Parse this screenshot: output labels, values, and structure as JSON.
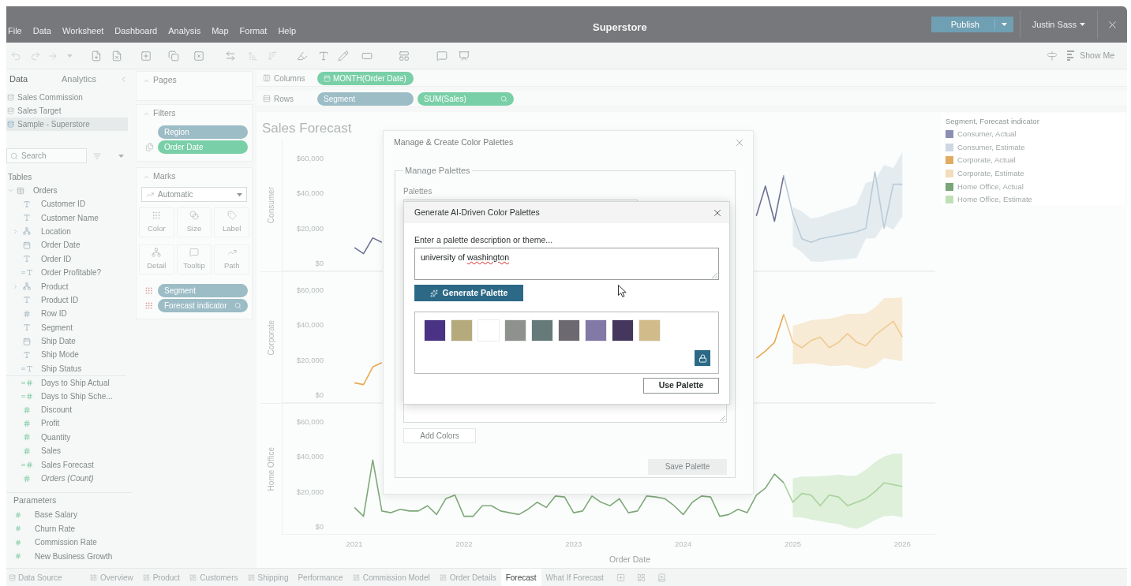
{
  "window": {
    "title": "Superstore",
    "menu": [
      "File",
      "Data",
      "Worksheet",
      "Dashboard",
      "Analysis",
      "Map",
      "Format",
      "Help"
    ],
    "publish": "Publish",
    "user": "Justin Sass"
  },
  "toolbar": {
    "show_me": "Show Me"
  },
  "data_pane": {
    "tabs": [
      {
        "label": "Data",
        "selected": true
      },
      {
        "label": "Analytics",
        "selected": false
      }
    ],
    "data_sources": [
      {
        "label": "Sales Commission",
        "selected": false
      },
      {
        "label": "Sales Target",
        "selected": false
      },
      {
        "label": "Sample - Superstore",
        "selected": true
      }
    ],
    "search": {
      "placeholder": "Search"
    },
    "tables_heading": "Tables",
    "tables": [
      {
        "label": "Orders",
        "expanded": true,
        "children": [
          {
            "label": "Customer ID",
            "kind": "string",
            "measure": false,
            "calculated": false
          },
          {
            "label": "Customer Name",
            "kind": "string",
            "measure": false,
            "calculated": false
          },
          {
            "label": "Location",
            "kind": "hierarchy",
            "measure": false,
            "calculated": false,
            "expanded": false
          },
          {
            "label": "Order Date",
            "kind": "date",
            "measure": false,
            "calculated": false
          },
          {
            "label": "Order ID",
            "kind": "string",
            "measure": false,
            "calculated": false
          },
          {
            "label": "Order Profitable?",
            "kind": "string",
            "measure": false,
            "calculated": true
          },
          {
            "label": "Product",
            "kind": "hierarchy",
            "measure": false,
            "calculated": false,
            "expanded": false
          },
          {
            "label": "Product ID",
            "kind": "string",
            "measure": false,
            "calculated": false
          },
          {
            "label": "Row ID",
            "kind": "number",
            "measure": false,
            "calculated": false
          },
          {
            "label": "Segment",
            "kind": "string",
            "measure": false,
            "calculated": false
          },
          {
            "label": "Ship Date",
            "kind": "date",
            "measure": false,
            "calculated": false
          },
          {
            "label": "Ship Mode",
            "kind": "string",
            "measure": false,
            "calculated": false
          },
          {
            "label": "Ship Status",
            "kind": "string",
            "measure": false,
            "calculated": true
          },
          {
            "label": "Days to Ship Actual",
            "kind": "number",
            "measure": true,
            "calculated": true
          },
          {
            "label": "Days to Ship Sche...",
            "kind": "number",
            "measure": true,
            "calculated": true
          },
          {
            "label": "Discount",
            "kind": "number",
            "measure": true,
            "calculated": false
          },
          {
            "label": "Profit",
            "kind": "number",
            "measure": true,
            "calculated": false
          },
          {
            "label": "Quantity",
            "kind": "number",
            "measure": true,
            "calculated": false
          },
          {
            "label": "Sales",
            "kind": "number",
            "measure": true,
            "calculated": false
          },
          {
            "label": "Sales Forecast",
            "kind": "number",
            "measure": true,
            "calculated": true
          },
          {
            "label": "Orders (Count)",
            "kind": "number",
            "measure": true,
            "calculated": false,
            "italic": true
          }
        ]
      }
    ],
    "parameters_heading": "Parameters",
    "parameters": [
      {
        "label": "Base Salary"
      },
      {
        "label": "Churn Rate"
      },
      {
        "label": "Commission Rate"
      },
      {
        "label": "New Business Growth"
      }
    ]
  },
  "shelves": {
    "pages": {
      "title": "Pages",
      "expanded": true
    },
    "filters": {
      "title": "Filters",
      "expanded": true,
      "pills": [
        {
          "label": "Region",
          "kind": "discrete",
          "shared": false
        },
        {
          "label": "Order Date",
          "kind": "continuous",
          "shared": true
        }
      ]
    },
    "marks": {
      "title": "Marks",
      "expanded": true,
      "mark_type": "Automatic",
      "cards": [
        {
          "label": "Color",
          "kind": "color"
        },
        {
          "label": "Size",
          "kind": "size"
        },
        {
          "label": "Label",
          "kind": "label"
        },
        {
          "label": "Detail",
          "kind": "detail"
        },
        {
          "label": "Tooltip",
          "kind": "tooltip"
        },
        {
          "label": "Path",
          "kind": "path"
        }
      ],
      "pills": [
        {
          "label": "Segment",
          "kind": "discrete",
          "forecast": false
        },
        {
          "label": "Forecast indicator",
          "kind": "discrete",
          "forecast": true
        }
      ]
    }
  },
  "columns_shelf": {
    "label": "Columns",
    "pills": [
      {
        "label": "MONTH(Order Date)",
        "kind": "continuous",
        "date": true,
        "forecast": false
      }
    ]
  },
  "rows_shelf": {
    "label": "Rows",
    "pills": [
      {
        "label": "Segment",
        "kind": "discrete",
        "date": false,
        "forecast": false
      },
      {
        "label": "SUM(Sales)",
        "kind": "continuous",
        "date": false,
        "forecast": true
      }
    ]
  },
  "view": {
    "title": "Sales Forecast",
    "panes": [
      {
        "label": "Consumer",
        "chart_data": {
          "type": "line",
          "x": [
            2021,
            2021.083,
            2021.167,
            2021.25,
            2024.667,
            2024.75,
            2024.833,
            2024.917,
            2025,
            2025.083,
            2025.167,
            2025.25,
            2025.333,
            2025.417,
            2025.5,
            2025.583,
            2025.667,
            2025.75,
            2025.833,
            2025.917,
            2026
          ],
          "xlim": [
            2020.344,
            2026.3
          ],
          "ylim": [
            -4500,
            70400
          ],
          "yticks": [
            {
              "value": 0,
              "label": "$0"
            },
            {
              "value": 20000,
              "label": "$20,000"
            },
            {
              "value": 40000,
              "label": "$40,000"
            },
            {
              "value": 60000,
              "label": "$60,000"
            }
          ],
          "series": [
            {
              "color": "#6e7193",
              "values": [
                9000,
                5500,
                14500,
                12000,
                27000,
                44000,
                24000,
                50000,
                null,
                null,
                null,
                null,
                null,
                null,
                null,
                null,
                null,
                null,
                null,
                null,
                null
              ]
            },
            {
              "color": "#b9cbd8",
              "values": [
                null,
                null,
                null,
                null,
                null,
                null,
                null,
                50000,
                28000,
                14000,
                12000,
                14000,
                15000,
                16000,
                17000,
                18000,
                20000,
                52000,
                20000,
                45000,
                45000
              ]
            }
          ]
        }
      },
      {
        "label": "Corporate",
        "chart_data": {
          "type": "line",
          "x": [
            2021,
            2021.083,
            2021.167,
            2021.25,
            2024.667,
            2024.75,
            2024.833,
            2024.917,
            2025,
            2025.083,
            2025.167,
            2025.25,
            2025.333,
            2025.417,
            2025.5,
            2025.583,
            2025.667,
            2025.75,
            2025.833,
            2025.917,
            2026
          ],
          "xlim": [
            2020.344,
            2026.3
          ],
          "ylim": [
            -4500,
            70400
          ],
          "yticks": [
            {
              "value": 0,
              "label": "$0"
            },
            {
              "value": 20000,
              "label": "$20,000"
            },
            {
              "value": 40000,
              "label": "$40,000"
            },
            {
              "value": 60000,
              "label": "$60,000"
            }
          ],
          "series": [
            {
              "color": "#e9a94e",
              "values": [
                7000,
                6000,
                16000,
                18500,
                21000,
                25000,
                30000,
                46000,
                null,
                null,
                null,
                null,
                null,
                null,
                null,
                null,
                null,
                null,
                null,
                null,
                null
              ]
            },
            {
              "color": "#f0c98f",
              "values": [
                null,
                null,
                null,
                null,
                null,
                null,
                null,
                46000,
                30000,
                27000,
                31000,
                33000,
                27000,
                30000,
                35000,
                30000,
                28000,
                34000,
                38000,
                42000,
                33000
              ]
            }
          ]
        }
      },
      {
        "label": "Home Office",
        "chart_data": {
          "type": "line",
          "xlabel": "Order Date",
          "x": [
            2021,
            2021.083,
            2021.167,
            2021.25,
            2021.333,
            2021.417,
            2021.5,
            2021.583,
            2021.667,
            2021.75,
            2021.833,
            2021.917,
            2022,
            2022.083,
            2022.167,
            2022.25,
            2022.333,
            2022.417,
            2022.5,
            2022.583,
            2022.667,
            2022.75,
            2022.833,
            2022.917,
            2023,
            2023.083,
            2023.167,
            2023.25,
            2023.333,
            2023.417,
            2023.5,
            2023.583,
            2023.667,
            2023.75,
            2023.833,
            2023.917,
            2024,
            2024.083,
            2024.167,
            2024.25,
            2024.333,
            2024.417,
            2024.5,
            2024.583,
            2024.667,
            2024.75,
            2024.833,
            2024.917,
            2025,
            2025.083,
            2025.167,
            2025.25,
            2025.333,
            2025.417,
            2025.5,
            2025.583,
            2025.667,
            2025.75,
            2025.833,
            2025.917,
            2026
          ],
          "xlim": [
            2020.344,
            2026.3
          ],
          "ylim": [
            -4500,
            70400
          ],
          "xticks": [
            2021,
            2022,
            2023,
            2024,
            2025,
            2026
          ],
          "yticks": [
            {
              "value": 0,
              "label": "$0"
            },
            {
              "value": 20000,
              "label": "$20,000"
            },
            {
              "value": 40000,
              "label": "$40,000"
            },
            {
              "value": 60000,
              "label": "$60,000"
            }
          ],
          "series": [
            {
              "color": "#7fa879",
              "values": [
                11000,
                6000,
                38000,
                9000,
                8000,
                10000,
                9000,
                9000,
                12000,
                7000,
                16000,
                18000,
                6000,
                6000,
                12000,
                12000,
                9000,
                8000,
                7000,
                10000,
                14000,
                11000,
                17500,
                17000,
                8000,
                9000,
                17500,
                14000,
                12000,
                16000,
                8000,
                9000,
                17500,
                17000,
                16000,
                12000,
                7000,
                14000,
                17500,
                17000,
                6000,
                7000,
                10000,
                8000,
                18000,
                22000,
                30000,
                25000,
                null,
                null,
                null,
                null,
                null,
                null,
                null,
                null,
                null,
                null,
                null,
                null,
                null
              ]
            },
            {
              "color": "#a9d39c",
              "values": [
                null,
                null,
                null,
                null,
                null,
                null,
                null,
                null,
                null,
                null,
                null,
                null,
                null,
                null,
                null,
                null,
                null,
                null,
                null,
                null,
                null,
                null,
                null,
                null,
                null,
                null,
                null,
                null,
                null,
                null,
                null,
                null,
                null,
                null,
                null,
                null,
                null,
                null,
                null,
                null,
                null,
                null,
                null,
                null,
                null,
                null,
                null,
                25000,
                14000,
                19000,
                18000,
                12000,
                18000,
                17000,
                12000,
                14000,
                16000,
                20000,
                25000,
                24000,
                23000
              ]
            }
          ]
        }
      }
    ]
  },
  "legend": {
    "title": "Segment, Forecast indicator",
    "items": [
      {
        "label": "Consumer, Actual",
        "color": "#8b8fb3"
      },
      {
        "label": "Consumer, Estimate",
        "color": "#cdd8e2"
      },
      {
        "label": "Corporate, Actual",
        "color": "#e2ab62"
      },
      {
        "label": "Corporate, Estimate",
        "color": "#f1dcbc"
      },
      {
        "label": "Home Office, Actual",
        "color": "#78a678"
      },
      {
        "label": "Home Office, Estimate",
        "color": "#bfe0b5"
      }
    ]
  },
  "palette_dialog": {
    "title": "Manage & Create Color Palettes",
    "group_title": "Manage Palettes",
    "palettes_label": "Palettes",
    "add_colors": {
      "label": "Add Colors",
      "disabled": true
    },
    "save": {
      "label": "Save Palette",
      "disabled": true
    }
  },
  "ai_dialog": {
    "title": "Generate AI-Driven Color Palettes",
    "prompt_label": "Enter a palette description or theme...",
    "prompt": {
      "words": [
        {
          "text": "university",
          "misspelled": false
        },
        {
          "text": "of",
          "misspelled": false
        },
        {
          "text": "washington",
          "misspelled": true
        }
      ]
    },
    "generate": "Generate Palette",
    "swatches": [
      {
        "color": "#4a3384"
      },
      {
        "color": "#b4aa7c"
      },
      {
        "color": "#ffffff"
      },
      {
        "color": "#8f918f"
      },
      {
        "color": "#667a7a"
      },
      {
        "color": "#6c6a70"
      },
      {
        "color": "#8379a6"
      },
      {
        "color": "#45365e"
      },
      {
        "color": "#d2bb8a"
      }
    ],
    "use": "Use Palette"
  },
  "sheet_tabs": {
    "data_source": "Data Source",
    "sheets": [
      {
        "label": "Overview",
        "kind": "dashboard",
        "selected": false
      },
      {
        "label": "Product",
        "kind": "dashboard",
        "selected": false
      },
      {
        "label": "Customers",
        "kind": "dashboard",
        "selected": false
      },
      {
        "label": "Shipping",
        "kind": "dashboard",
        "selected": false
      },
      {
        "label": "Performance",
        "kind": "worksheet",
        "selected": false
      },
      {
        "label": "Commission Model",
        "kind": "dashboard",
        "selected": false
      },
      {
        "label": "Order Details",
        "kind": "dashboard",
        "selected": false
      },
      {
        "label": "Forecast",
        "kind": "worksheet",
        "selected": true
      },
      {
        "label": "What If Forecast",
        "kind": "worksheet",
        "selected": false
      }
    ]
  }
}
